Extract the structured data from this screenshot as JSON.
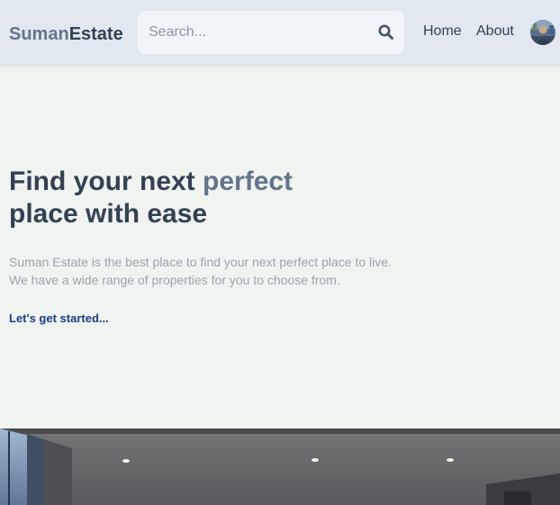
{
  "brand": {
    "part1": "Suman",
    "part2": "Estate"
  },
  "search": {
    "placeholder": "Search..."
  },
  "nav": {
    "home": "Home",
    "about": "About"
  },
  "hero": {
    "title_part1": "Find your next ",
    "title_accent": "perfect",
    "title_line2": "place with ease",
    "description_line1": "Suman Estate is the best place to find your next perfect place to live.",
    "description_line2": "We have a wide range of properties for you to choose from.",
    "cta": "Let's get started..."
  },
  "colors": {
    "header_bg": "#e2e8f0",
    "page_bg": "#f0f4f1",
    "heading": "#334155",
    "accent": "#64748b",
    "link": "#1e3a8a"
  },
  "icons": {
    "search": "search-icon",
    "avatar": "user-avatar"
  }
}
